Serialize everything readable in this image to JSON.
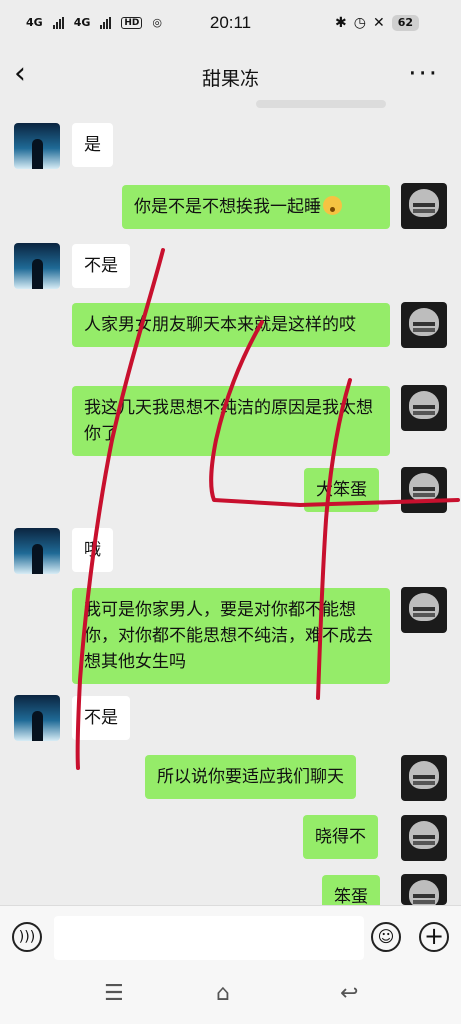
{
  "status": {
    "signal_1": "4G",
    "signal_2": "4G",
    "hd": "HD",
    "time": "20:11",
    "battery": "62"
  },
  "header": {
    "title": "甜果冻"
  },
  "messages": [
    {
      "side": "left",
      "text": "是"
    },
    {
      "side": "right",
      "text": "你是不是不想挨我一起睡"
    },
    {
      "side": "left",
      "text": "不是"
    },
    {
      "side": "right",
      "text": "人家男女朋友聊天本来就是这样的哎"
    },
    {
      "side": "right",
      "text": "我这几天我思想不纯洁的原因是我太想你了"
    },
    {
      "side": "right",
      "text": "大笨蛋"
    },
    {
      "side": "left",
      "text": "哦"
    },
    {
      "side": "right",
      "text": "我可是你家男人，要是对你都不能想你，对你都不能思想不纯洁，难不成去想其他女生吗"
    },
    {
      "side": "left",
      "text": "不是"
    },
    {
      "side": "right",
      "text": "所以说你要适应我们聊天"
    },
    {
      "side": "right",
      "text": "晓得不"
    },
    {
      "side": "right",
      "text": "笨蛋"
    }
  ],
  "icons": {
    "back": "chevron-left-icon",
    "more": "more-dots-icon",
    "voice": "voice-icon",
    "emoji": "emoji-icon",
    "plus": "plus-icon"
  },
  "colors": {
    "right_bubble": "#95ec69",
    "left_bubble": "#ffffff",
    "background": "#ededed",
    "annotation": "#c8102e"
  }
}
